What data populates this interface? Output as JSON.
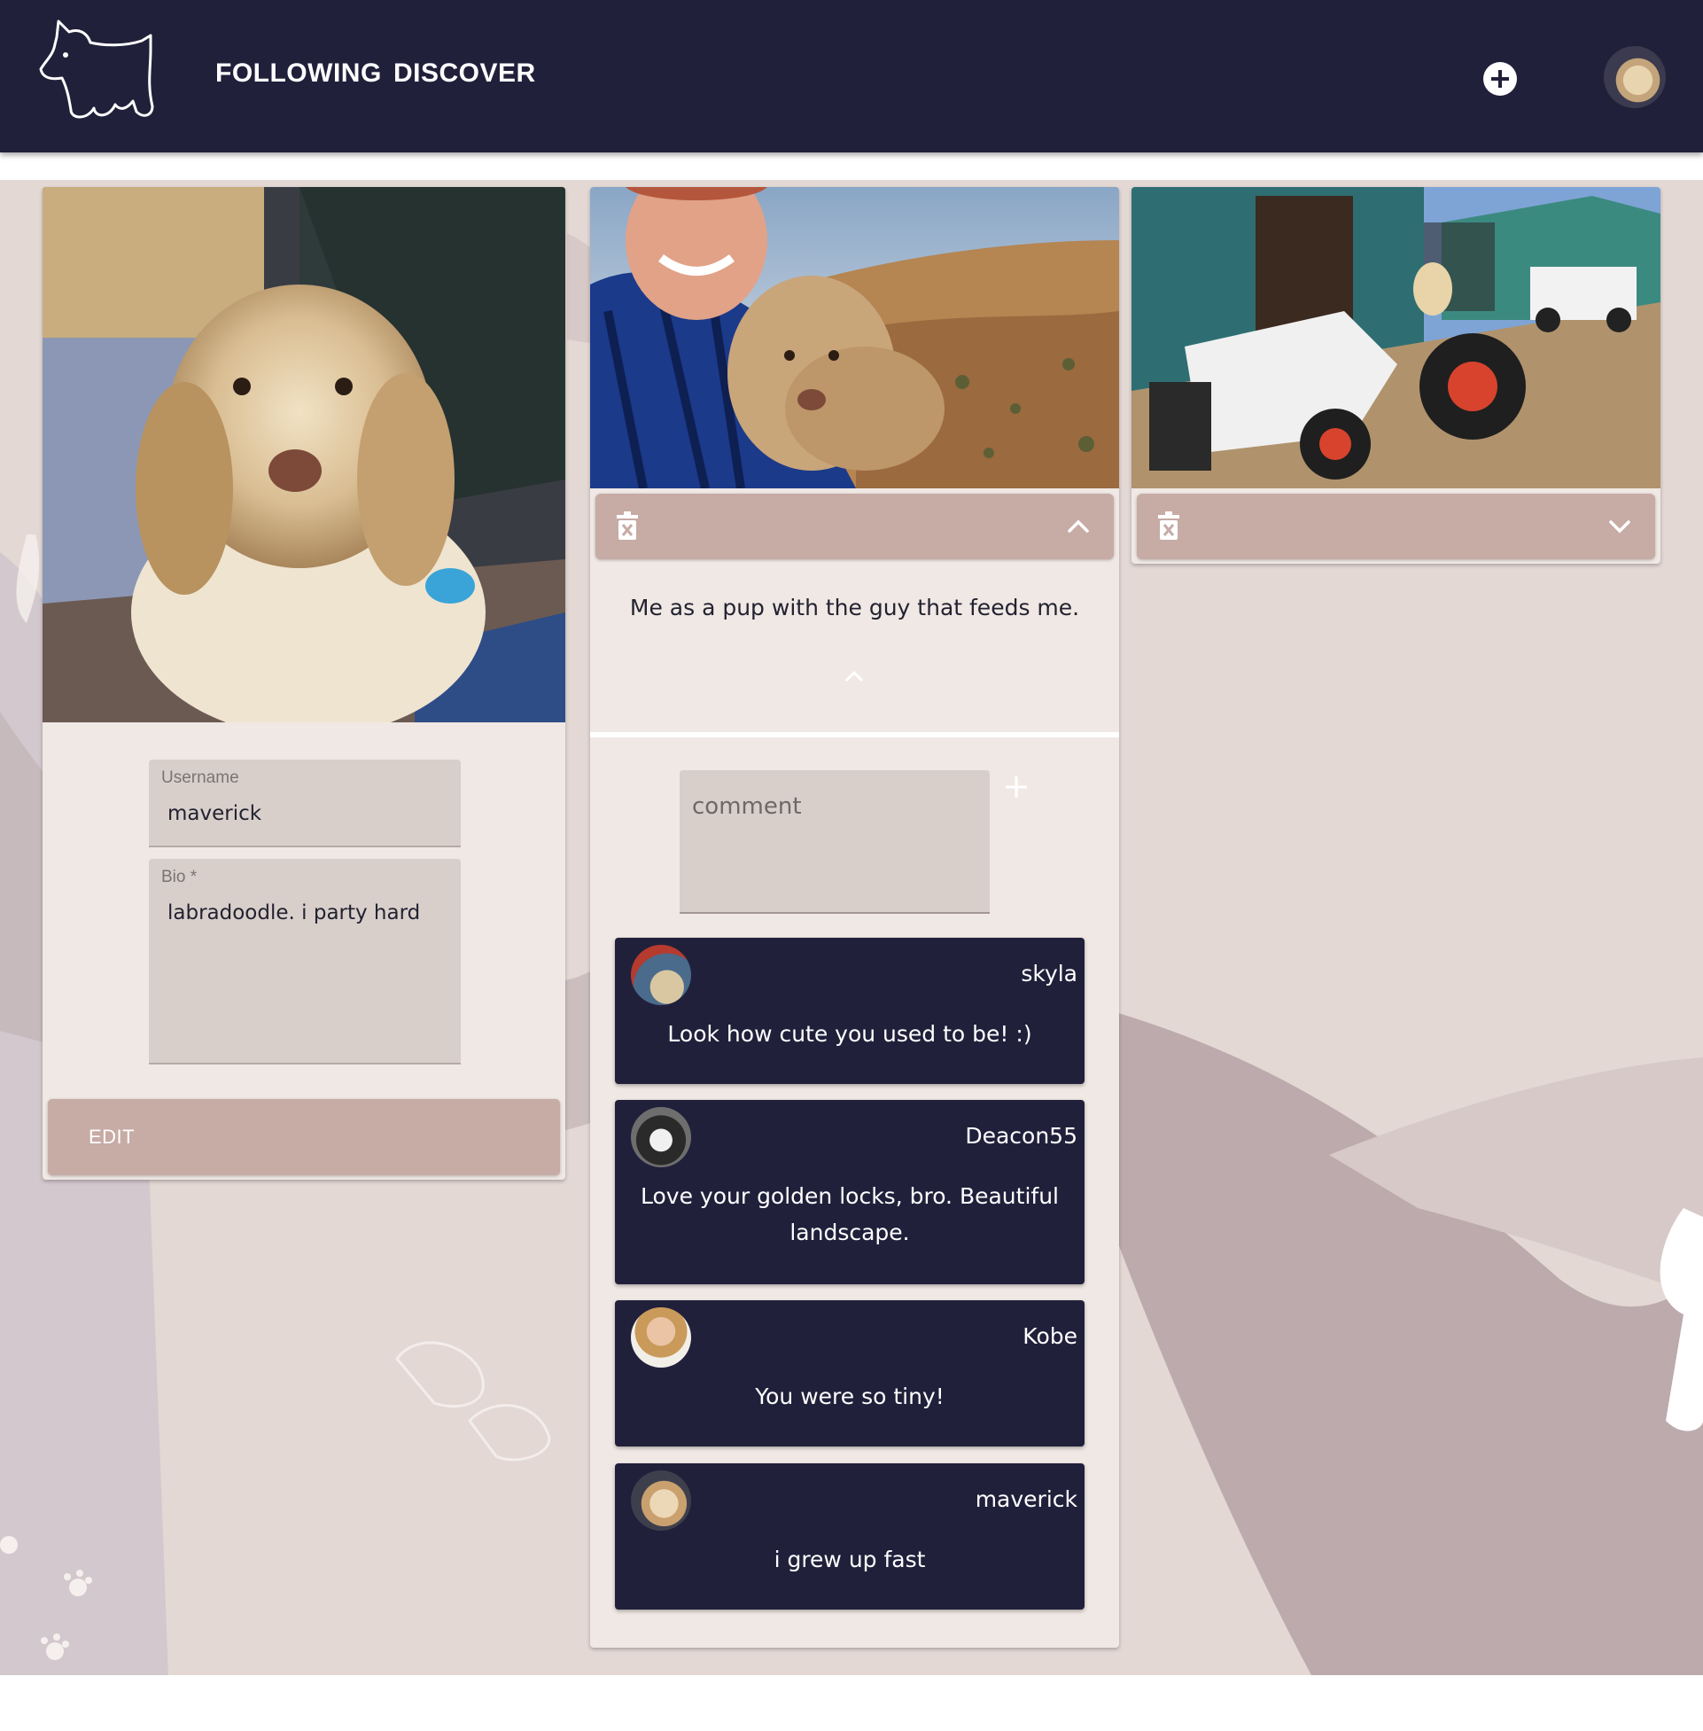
{
  "nav": {
    "logo_icon": "dog-outline-logo",
    "following": "FOLLOWING",
    "discover": "DISCOVER",
    "add_icon": "plus-circle-icon",
    "avatar_icon": "user-avatar"
  },
  "colors": {
    "header": "#21203b",
    "card": "#f0e8e4",
    "accent": "#c7aba5",
    "comment_bg": "#21203b",
    "background": "#e3d8d4"
  },
  "profile": {
    "photo_alt": "dog-portrait-photo",
    "username_label": "Username",
    "username_value": "maverick",
    "bio_label": "Bio *",
    "bio_value": "labradoodle. i party hard",
    "edit_label": "EDIT"
  },
  "posts": [
    {
      "photo": "man-with-puppy-photo",
      "caption": "Me as a pup with the guy that feeds me.",
      "expanded": true,
      "comment_placeholder": "comment",
      "comments": [
        {
          "user": "skyla",
          "text": "Look how cute you used to be! :)"
        },
        {
          "user": "Deacon55",
          "text": "Love your golden locks, bro. Beautiful landscape."
        },
        {
          "user": "Kobe",
          "text": "You were so tiny!"
        },
        {
          "user": "maverick",
          "text": "i grew up fast"
        }
      ]
    },
    {
      "photo": "dog-on-tractor-photo",
      "expanded": false
    }
  ]
}
